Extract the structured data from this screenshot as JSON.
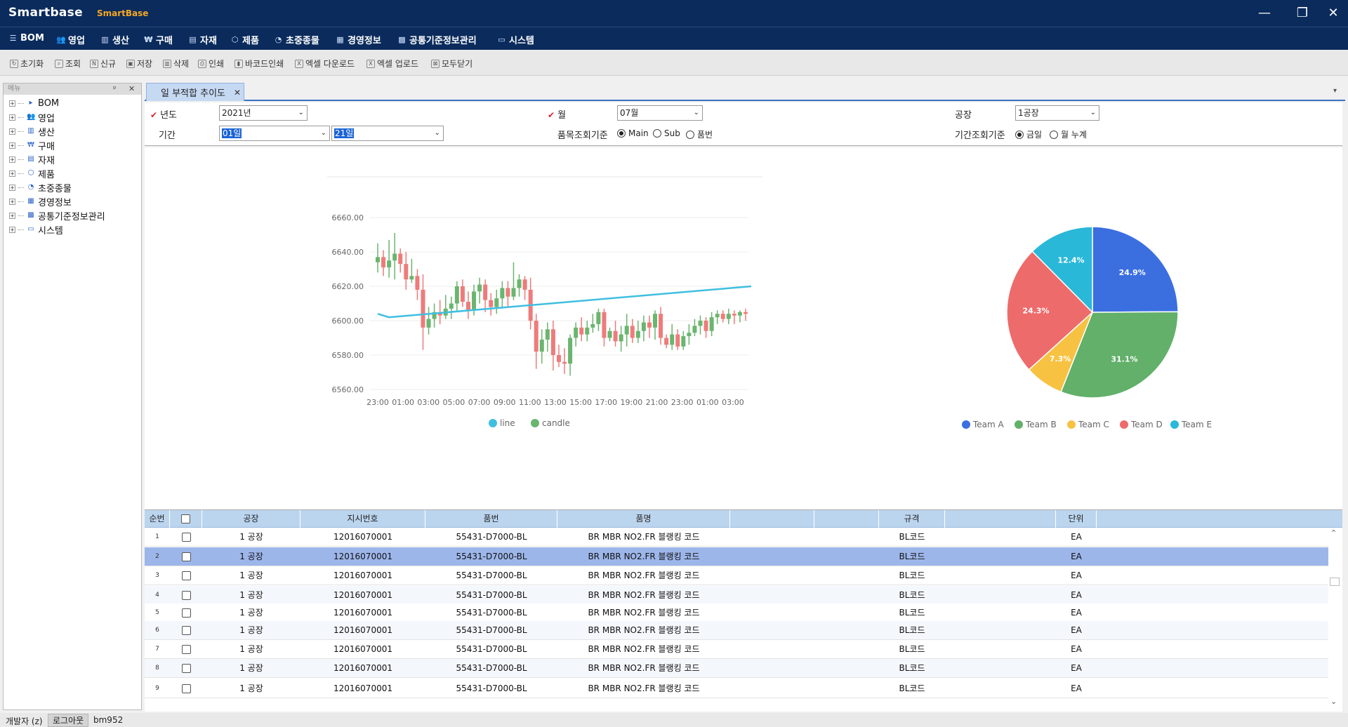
{
  "titlebar": {
    "logo": "Smartbase",
    "app_name": "SmartBase",
    "minimize": "—",
    "restore": "❐",
    "close": "✕"
  },
  "mainmenu": [
    {
      "label": "BOM",
      "icon": "list-icon",
      "glyph": "☰"
    },
    {
      "label": "영업",
      "icon": "users-icon",
      "glyph": "👥"
    },
    {
      "label": "생산",
      "icon": "bar-chart-icon",
      "glyph": "▥"
    },
    {
      "label": "구매",
      "icon": "won-icon",
      "glyph": "₩"
    },
    {
      "label": "자재",
      "icon": "document-icon",
      "glyph": "▤"
    },
    {
      "label": "제품",
      "icon": "box-icon",
      "glyph": "⬡"
    },
    {
      "label": "초중종물",
      "icon": "pie-icon",
      "glyph": "◔"
    },
    {
      "label": "경영정보",
      "icon": "calendar-icon",
      "glyph": "▦"
    },
    {
      "label": "공통기준정보관리",
      "icon": "network-icon",
      "glyph": "▩"
    },
    {
      "label": "시스템",
      "icon": "monitor-icon",
      "glyph": "▭"
    }
  ],
  "toolbar": [
    {
      "label": "초기화",
      "icon": "refresh-icon",
      "glyph": "↻"
    },
    {
      "label": "조회",
      "icon": "search-icon",
      "glyph": "⌕"
    },
    {
      "label": "신규",
      "icon": "new-icon",
      "glyph": "N"
    },
    {
      "label": "저장",
      "icon": "save-icon",
      "glyph": "▣"
    },
    {
      "label": "삭제",
      "icon": "trash-icon",
      "glyph": "▥"
    },
    {
      "label": "인쇄",
      "icon": "print-icon",
      "glyph": "⎙"
    },
    {
      "label": "바코드인쇄",
      "icon": "barcode-icon",
      "glyph": "▮"
    },
    {
      "label": "엑셀 다운로드",
      "icon": "excel-download-icon",
      "glyph": "X"
    },
    {
      "label": "엑셀 업로드",
      "icon": "excel-upload-icon",
      "glyph": "X"
    },
    {
      "label": "모두닫기",
      "icon": "close-all-icon",
      "glyph": "⊠"
    }
  ],
  "sidepanel": {
    "title": "메뉴",
    "pin": "ᵖ",
    "close": "✕",
    "items": [
      {
        "label": "BOM",
        "icon": "play-icon",
        "glyph": "▸"
      },
      {
        "label": "영업",
        "icon": "users-icon",
        "glyph": "👥"
      },
      {
        "label": "생산",
        "icon": "bar-chart-icon",
        "glyph": "▥"
      },
      {
        "label": "구매",
        "icon": "won-icon",
        "glyph": "₩"
      },
      {
        "label": "자재",
        "icon": "document-icon",
        "glyph": "▤"
      },
      {
        "label": "제품",
        "icon": "box-icon",
        "glyph": "⬡"
      },
      {
        "label": "초중종물",
        "icon": "pie-icon",
        "glyph": "◔"
      },
      {
        "label": "경영정보",
        "icon": "calendar-icon",
        "glyph": "▦"
      },
      {
        "label": "공통기준정보관리",
        "icon": "network-icon",
        "glyph": "▩"
      },
      {
        "label": "시스템",
        "icon": "monitor-icon",
        "glyph": "▭"
      }
    ]
  },
  "tab": {
    "label": "일 부적합 추이도",
    "close": "✕",
    "menu": "▾"
  },
  "filters": {
    "year_label": "년도",
    "year_value": "2021년",
    "month_label": "월",
    "month_value": "07월",
    "factory_label": "공장",
    "factory_value": "1공장",
    "period_label": "기간",
    "period_from": "01일",
    "period_to": "21일",
    "item_criteria_label": "품목조회기준",
    "item_criteria_options": [
      "Main",
      "Sub",
      "품번"
    ],
    "period_criteria_label": "기간조회기준",
    "period_criteria_options": [
      "금일",
      "월 누계"
    ]
  },
  "chart_data": [
    {
      "type": "candlestick+line",
      "title": "",
      "ylim": [
        6560,
        6660
      ],
      "yticks": [
        "6560.00",
        "6580.00",
        "6600.00",
        "6620.00",
        "6640.00",
        "6660.00"
      ],
      "xticks": [
        "23:00",
        "01:00",
        "03:00",
        "05:00",
        "07:00",
        "09:00",
        "11:00",
        "13:00",
        "15:00",
        "17:00",
        "19:00",
        "21:00",
        "23:00",
        "01:00",
        "03:00"
      ],
      "legend": [
        "line",
        "candle"
      ],
      "line_color": "#3fbfe0",
      "up_color": "#6ab56f",
      "down_color": "#ee7b7b",
      "line": [
        [
          0,
          6604
        ],
        [
          2,
          6602
        ],
        [
          66,
          6620
        ]
      ],
      "candles": [
        [
          6634,
          6637,
          6628,
          6645
        ],
        [
          6637,
          6631,
          6626,
          6641
        ],
        [
          6631,
          6635,
          6625,
          6647
        ],
        [
          6635,
          6639,
          6624,
          6651
        ],
        [
          6639,
          6633,
          6628,
          6642
        ],
        [
          6633,
          6624,
          6618,
          6640
        ],
        [
          6624,
          6626,
          6622,
          6636
        ],
        [
          6626,
          6618,
          6612,
          6630
        ],
        [
          6618,
          6596,
          6583,
          6627
        ],
        [
          6596,
          6601,
          6592,
          6608
        ],
        [
          6601,
          6605,
          6596,
          6610
        ],
        [
          6605,
          6603,
          6598,
          6612
        ],
        [
          6603,
          6607,
          6601,
          6615
        ],
        [
          6607,
          6610,
          6601,
          6614
        ],
        [
          6610,
          6620,
          6605,
          6623
        ],
        [
          6620,
          6611,
          6608,
          6624
        ],
        [
          6611,
          6606,
          6601,
          6617
        ],
        [
          6606,
          6617,
          6603,
          6621
        ],
        [
          6617,
          6621,
          6610,
          6625
        ],
        [
          6621,
          6612,
          6605,
          6624
        ],
        [
          6612,
          6608,
          6603,
          6616
        ],
        [
          6608,
          6613,
          6604,
          6618
        ],
        [
          6613,
          6619,
          6607,
          6623
        ],
        [
          6619,
          6614,
          6608,
          6623
        ],
        [
          6614,
          6619,
          6612,
          6634
        ],
        [
          6619,
          6624,
          6614,
          6627
        ],
        [
          6624,
          6618,
          6612,
          6626
        ],
        [
          6618,
          6600,
          6595,
          6625
        ],
        [
          6600,
          6582,
          6572,
          6604
        ],
        [
          6582,
          6589,
          6575,
          6595
        ],
        [
          6589,
          6595,
          6582,
          6599
        ],
        [
          6595,
          6580,
          6571,
          6600
        ],
        [
          6580,
          6576,
          6573,
          6586
        ],
        [
          6576,
          6575,
          6569,
          6584
        ],
        [
          6575,
          6590,
          6568,
          6592
        ],
        [
          6590,
          6596,
          6585,
          6599
        ],
        [
          6596,
          6592,
          6588,
          6602
        ],
        [
          6592,
          6596,
          6588,
          6600
        ],
        [
          6596,
          6598,
          6593,
          6604
        ],
        [
          6598,
          6605,
          6594,
          6607
        ],
        [
          6605,
          6590,
          6585,
          6607
        ],
        [
          6590,
          6594,
          6588,
          6596
        ],
        [
          6594,
          6588,
          6585,
          6600
        ],
        [
          6588,
          6592,
          6582,
          6597
        ],
        [
          6592,
          6597,
          6585,
          6604
        ],
        [
          6597,
          6590,
          6587,
          6601
        ],
        [
          6590,
          6594,
          6587,
          6600
        ],
        [
          6594,
          6599,
          6588,
          6603
        ],
        [
          6599,
          6596,
          6590,
          6603
        ],
        [
          6596,
          6604,
          6589,
          6606
        ],
        [
          6604,
          6590,
          6586,
          6608
        ],
        [
          6590,
          6586,
          6584,
          6592
        ],
        [
          6586,
          6592,
          6583,
          6598
        ],
        [
          6592,
          6585,
          6583,
          6595
        ],
        [
          6585,
          6591,
          6583,
          6594
        ],
        [
          6591,
          6593,
          6586,
          6598
        ],
        [
          6593,
          6597,
          6591,
          6601
        ],
        [
          6597,
          6600,
          6592,
          6603
        ],
        [
          6600,
          6594,
          6590,
          6602
        ],
        [
          6594,
          6602,
          6591,
          6605
        ],
        [
          6602,
          6604,
          6598,
          6606
        ],
        [
          6604,
          6601,
          6599,
          6606
        ],
        [
          6601,
          6604,
          6598,
          6607
        ],
        [
          6604,
          6603,
          6598,
          6606
        ],
        [
          6603,
          6605,
          6599,
          6606
        ],
        [
          6605,
          6604,
          6600,
          6607
        ]
      ]
    },
    {
      "type": "pie",
      "title": "",
      "labels": [
        "Team A",
        "Team B",
        "Team C",
        "Team D",
        "Team E"
      ],
      "values": [
        24.9,
        31.1,
        7.3,
        24.3,
        12.4
      ],
      "value_labels": [
        "24.9%",
        "31.1%",
        "7.3%",
        "24.3%",
        "12.4%"
      ],
      "colors": [
        "#3b6fe0",
        "#62b06a",
        "#f7c242",
        "#ee6b6b",
        "#2ab8d8"
      ]
    }
  ],
  "grid": {
    "columns": [
      "순번",
      "",
      "공장",
      "지시번호",
      "품번",
      "품명",
      "",
      "",
      "규격",
      "",
      "단위"
    ],
    "rows": [
      [
        "1",
        "1 공장",
        "12016070001",
        "55431-D7000-BL",
        "BR MBR NO2.FR 블랭킹 코드",
        "BL코드",
        "EA"
      ],
      [
        "2",
        "1 공장",
        "12016070001",
        "55431-D7000-BL",
        "BR MBR NO2.FR 블랭킹 코드",
        "BL코드",
        "EA"
      ],
      [
        "3",
        "1 공장",
        "12016070001",
        "55431-D7000-BL",
        "BR MBR NO2.FR 블랭킹 코드",
        "BL코드",
        "EA"
      ],
      [
        "4",
        "1 공장",
        "12016070001",
        "55431-D7000-BL",
        "BR MBR NO2.FR 블랭킹 코드",
        "BL코드",
        "EA"
      ],
      [
        "5",
        "1 공장",
        "12016070001",
        "55431-D7000-BL",
        "BR MBR NO2.FR 블랭킹 코드",
        "BL코드",
        "EA"
      ],
      [
        "6",
        "1 공장",
        "12016070001",
        "55431-D7000-BL",
        "BR MBR NO2.FR 블랭킹 코드",
        "BL코드",
        "EA"
      ],
      [
        "7",
        "1 공장",
        "12016070001",
        "55431-D7000-BL",
        "BR MBR NO2.FR 블랭킹 코드",
        "BL코드",
        "EA"
      ],
      [
        "8",
        "1 공장",
        "12016070001",
        "55431-D7000-BL",
        "BR MBR NO2.FR 블랭킹 코드",
        "BL코드",
        "EA"
      ],
      [
        "9",
        "1 공장",
        "12016070001",
        "55431-D7000-BL",
        "BR MBR NO2.FR 블랭킹 코드",
        "BL코드",
        "EA"
      ]
    ],
    "selected_row": 2
  },
  "statusbar": {
    "user": "개발자 (z)",
    "logout": "로그아웃",
    "user_id": "bm952"
  }
}
